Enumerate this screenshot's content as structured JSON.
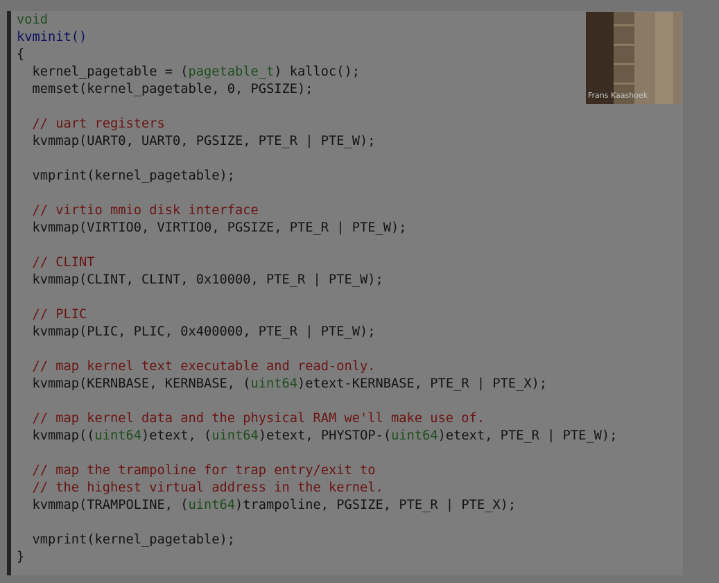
{
  "code_lines": [
    [
      {
        "t": "void",
        "c": "kw"
      }
    ],
    [
      {
        "t": "kvminit",
        "c": "fn"
      },
      {
        "t": "()",
        "c": "fn"
      }
    ],
    [
      {
        "t": "{",
        "c": ""
      }
    ],
    [
      {
        "t": "  kernel_pagetable = (",
        "c": ""
      },
      {
        "t": "pagetable_t",
        "c": "ty"
      },
      {
        "t": ") kalloc();",
        "c": ""
      }
    ],
    [
      {
        "t": "  memset(kernel_pagetable, 0, PGSIZE);",
        "c": ""
      }
    ],
    [],
    [
      {
        "t": "  // uart registers",
        "c": "cm"
      }
    ],
    [
      {
        "t": "  kvmmap(UART0, UART0, PGSIZE, PTE_R | PTE_W);",
        "c": ""
      }
    ],
    [],
    [
      {
        "t": "  vmprint(kernel_pagetable);",
        "c": ""
      }
    ],
    [],
    [
      {
        "t": "  // virtio mmio disk interface",
        "c": "cm"
      }
    ],
    [
      {
        "t": "  kvmmap(VIRTIO0, VIRTIO0, PGSIZE, PTE_R | PTE_W);",
        "c": ""
      }
    ],
    [],
    [
      {
        "t": "  // CLINT",
        "c": "cm"
      }
    ],
    [
      {
        "t": "  kvmmap(CLINT, CLINT, 0x10000, PTE_R | PTE_W);",
        "c": ""
      }
    ],
    [],
    [
      {
        "t": "  // PLIC",
        "c": "cm"
      }
    ],
    [
      {
        "t": "  kvmmap(PLIC, PLIC, 0x400000, PTE_R | PTE_W);",
        "c": ""
      }
    ],
    [],
    [
      {
        "t": "  // map kernel text executable and read-only.",
        "c": "cm"
      }
    ],
    [
      {
        "t": "  kvmmap(KERNBASE, KERNBASE, (",
        "c": ""
      },
      {
        "t": "uint64",
        "c": "ty"
      },
      {
        "t": ")etext-KERNBASE, PTE_R | PTE_X);",
        "c": ""
      }
    ],
    [],
    [
      {
        "t": "  // map kernel data and the physical RAM we'll make use of.",
        "c": "cm"
      }
    ],
    [
      {
        "t": "  kvmmap((",
        "c": ""
      },
      {
        "t": "uint64",
        "c": "ty"
      },
      {
        "t": ")etext, (",
        "c": ""
      },
      {
        "t": "uint64",
        "c": "ty"
      },
      {
        "t": ")etext, PHYSTOP-(",
        "c": ""
      },
      {
        "t": "uint64",
        "c": "ty"
      },
      {
        "t": ")etext, PTE_R | PTE_W);",
        "c": ""
      }
    ],
    [],
    [
      {
        "t": "  // map the trampoline for trap entry/exit to",
        "c": "cm"
      }
    ],
    [
      {
        "t": "  // the highest virtual address in the kernel.",
        "c": "cm"
      }
    ],
    [
      {
        "t": "  kvmmap(TRAMPOLINE, (",
        "c": ""
      },
      {
        "t": "uint64",
        "c": "ty"
      },
      {
        "t": ")trampoline, PGSIZE, PTE_R | PTE_X);",
        "c": ""
      }
    ],
    [],
    [
      {
        "t": "  vmprint(kernel_pagetable);",
        "c": ""
      }
    ],
    [
      {
        "t": "}",
        "c": ""
      }
    ]
  ],
  "video": {
    "participant_name": "Frans Kaashoek"
  },
  "colors": {
    "keyword": "#1f4d1f",
    "function": "#101060",
    "type": "#1f4d1f",
    "comment": "#6b1414",
    "text": "#141414",
    "background": "#7d7d7d"
  }
}
